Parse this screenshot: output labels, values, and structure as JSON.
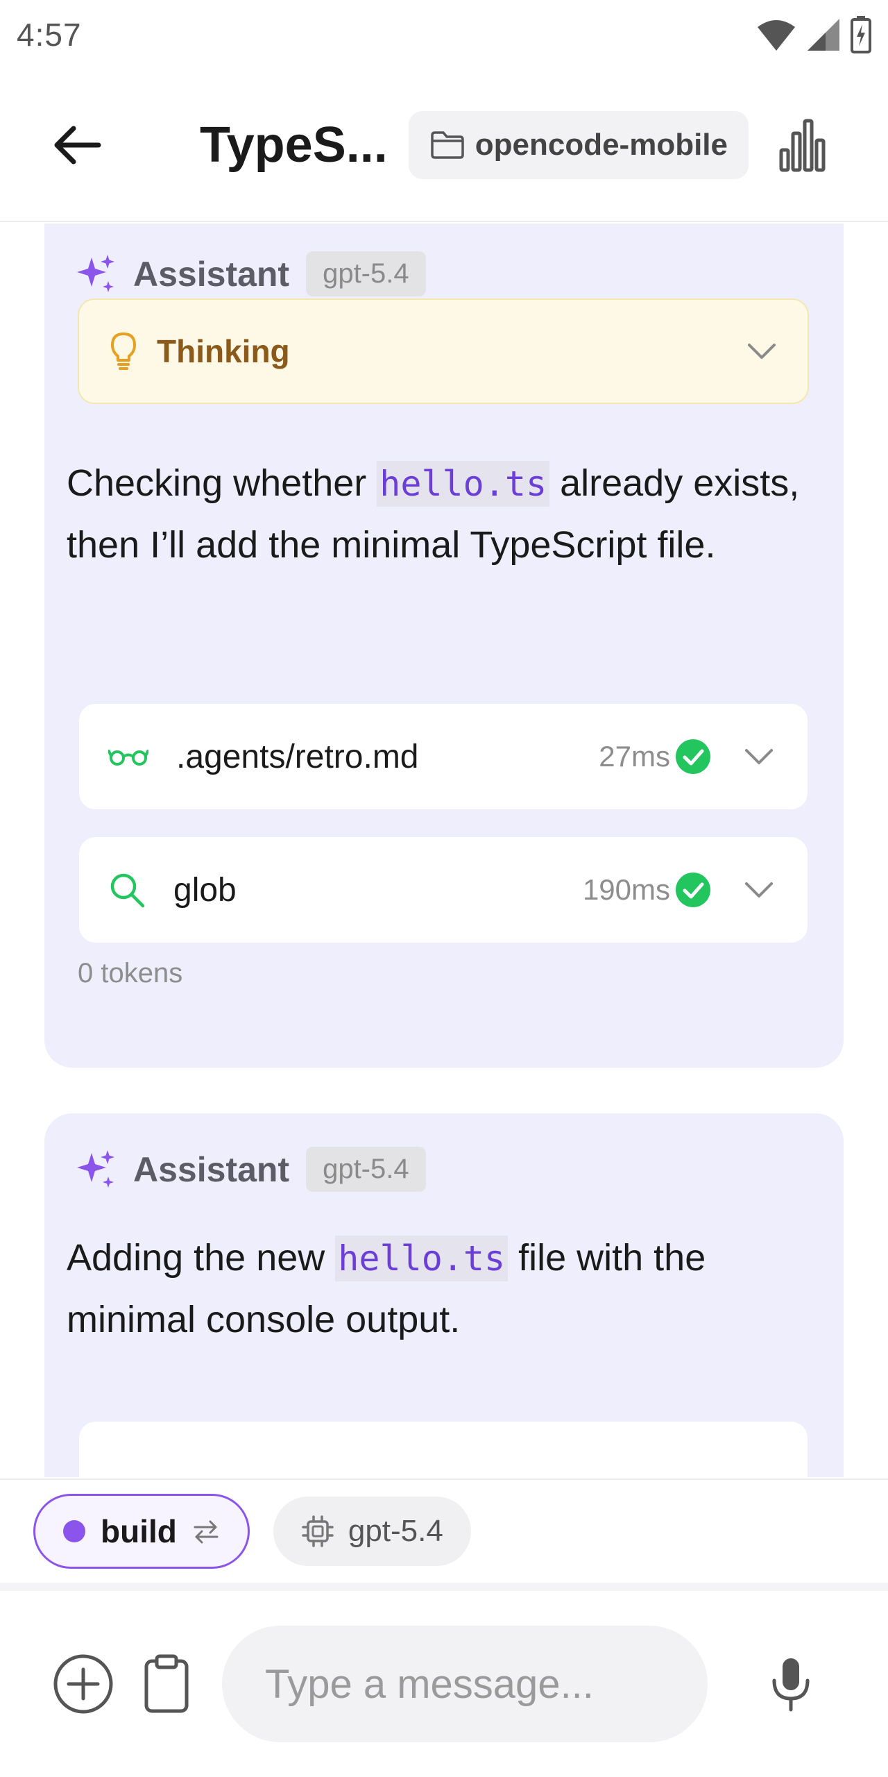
{
  "status_bar": {
    "time": "4:57"
  },
  "app_bar": {
    "title": "TypeS...",
    "project_chip": "opencode-mobile"
  },
  "messages": [
    {
      "role": "Assistant",
      "model": "gpt-5.4",
      "thinking_label": "Thinking",
      "text_parts": [
        "Checking whether ",
        "hello.ts",
        " already exists, then I’ll add the minimal TypeScript file."
      ],
      "tools": [
        {
          "icon": "glasses-icon",
          "name": ".agents/retro.md",
          "duration": "27ms",
          "status": "success"
        },
        {
          "icon": "search-icon",
          "name": "glob",
          "duration": "190ms",
          "status": "success"
        }
      ],
      "tokens": "0 tokens"
    },
    {
      "role": "Assistant",
      "model": "gpt-5.4",
      "text_parts": [
        "Adding the new ",
        "hello.ts",
        " file with the minimal console output."
      ]
    }
  ],
  "bottom": {
    "agent_chip": "build",
    "model_chip": "gpt-5.4",
    "input_placeholder": "Type a message..."
  },
  "colors": {
    "accent": "#8b55ec",
    "card_bg": "#efeefc",
    "success": "#22c55e",
    "thinking_bg": "#fdf9e6",
    "thinking_text": "#8b5a1a",
    "code_text": "#6b3fd6"
  }
}
